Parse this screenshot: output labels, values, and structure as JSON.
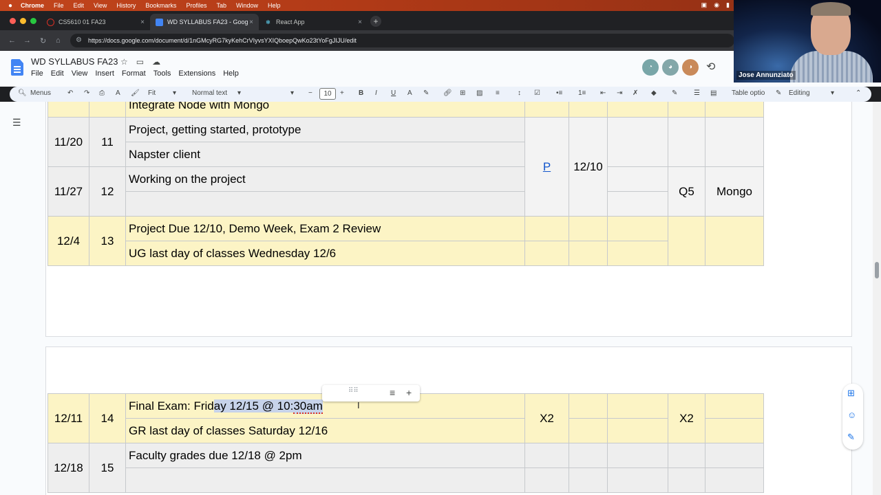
{
  "mac_menu": [
    "Chrome",
    "File",
    "Edit",
    "View",
    "History",
    "Bookmarks",
    "Profiles",
    "Tab",
    "Window",
    "Help"
  ],
  "tabs": [
    {
      "label": "CS5610 01 FA23",
      "close": "×"
    },
    {
      "label": "WD SYLLABUS FA23 - Goog",
      "close": "×"
    },
    {
      "label": "React App",
      "close": "×"
    }
  ],
  "url": "https://docs.google.com/document/d/1nGMcyRG7kyKehCrVIyvsYXIQboepQwKo23tYoFgJIJU/edit",
  "doc": {
    "title": "WD SYLLABUS FA23",
    "menus": [
      "File",
      "Edit",
      "View",
      "Insert",
      "Format",
      "Tools",
      "Extensions",
      "Help"
    ]
  },
  "toolbar": {
    "search": "Menus",
    "zoom": "Fit",
    "style": "Normal text",
    "font_size": "10",
    "table_options": "Table optio",
    "mode": "Editing"
  },
  "table1": {
    "partial_row": "Integrate Node with Mongo",
    "rows": [
      {
        "date": "11/20",
        "week": "11",
        "topic1": "Project, getting started, prototype",
        "topic2": "Napster client"
      },
      {
        "date": "11/27",
        "week": "12",
        "topic1": "Working on the project",
        "topic2": ""
      },
      {
        "date": "12/4",
        "week": "13",
        "topic1": "Project Due 12/10, Demo Week, Exam 2 Review",
        "topic2": "UG last day of classes Wednesday 12/6"
      }
    ],
    "p_link": "P",
    "due_date": "12/10",
    "quiz": "Q5",
    "tech": "Mongo"
  },
  "table2": {
    "rows": [
      {
        "date": "12/11",
        "week": "14",
        "topic1_pre": "Final Exam: Frid",
        "topic1_sel": "ay 12/15 @ 10:",
        "topic1_err": "30am",
        "topic2": "GR last day of classes Saturday 12/16",
        "exam": "X2",
        "exam2": "X2"
      },
      {
        "date": "12/18",
        "week": "15",
        "topic1": "Faculty grades due 12/18 @ 2pm",
        "topic2": ""
      }
    ]
  },
  "webcam": {
    "name": "Jose Annunziato"
  },
  "colors": {
    "highlight_row": "#fcf4c5",
    "gray_row": "#eeeeee",
    "selection": "#c7d3ea",
    "link": "#1155cc",
    "docs_blue": "#4285f4"
  }
}
